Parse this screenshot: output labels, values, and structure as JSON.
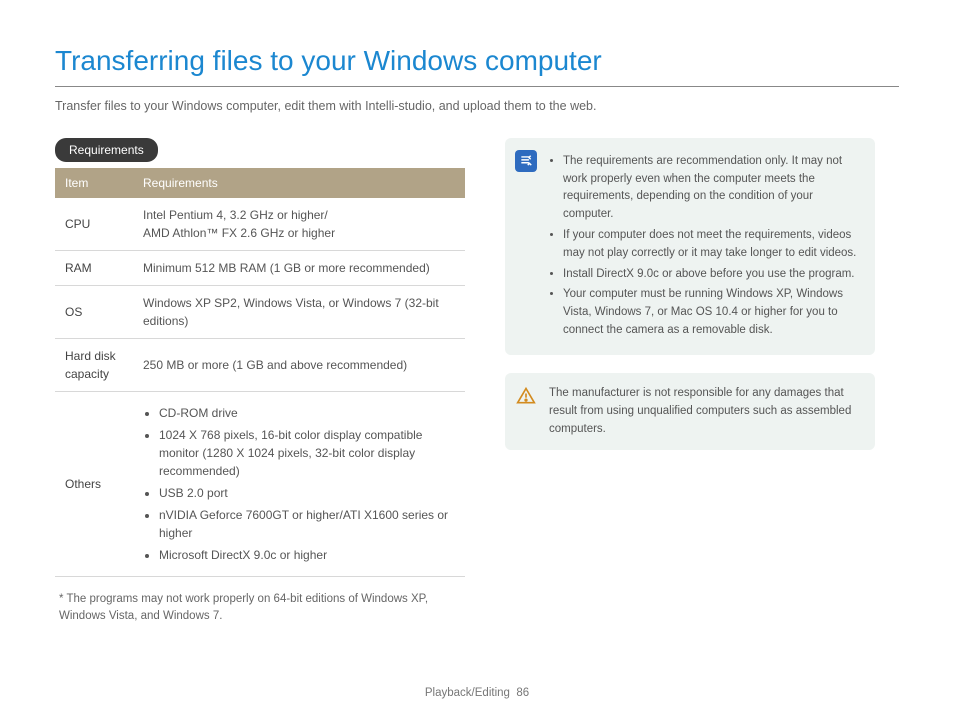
{
  "title": "Transferring files to your Windows computer",
  "intro": "Transfer files to your Windows computer, edit them with Intelli-studio, and upload them to the web.",
  "section_label": "Requirements",
  "table": {
    "head_item": "Item",
    "head_req": "Requirements",
    "rows": {
      "cpu_item": "CPU",
      "cpu_req": "Intel Pentium 4, 3.2 GHz or higher/\nAMD Athlon™ FX 2.6 GHz or higher",
      "ram_item": "RAM",
      "ram_req": "Minimum 512 MB RAM (1 GB or more recommended)",
      "os_item": "OS",
      "os_req": "Windows XP SP2, Windows Vista, or Windows 7 (32-bit editions)",
      "hdd_item": "Hard disk capacity",
      "hdd_req": "250 MB or more (1 GB and above recommended)",
      "others_item": "Others",
      "others_list": {
        "0": "CD-ROM drive",
        "1": "1024 X 768 pixels, 16-bit color display compatible monitor (1280 X 1024 pixels, 32-bit color display recommended)",
        "2": "USB 2.0 port",
        "3": "nVIDIA Geforce 7600GT or higher/ATI X1600 series or higher",
        "4": "Microsoft DirectX 9.0c or higher"
      }
    }
  },
  "footnote": "* The programs may not work properly on 64-bit editions of Windows XP, Windows Vista, and Windows 7.",
  "note_list": {
    "0": "The requirements are recommendation only. It may not work properly even when the computer meets the requirements, depending on the condition of your computer.",
    "1": "If your computer does not meet the requirements, videos may not play correctly or it may take longer to edit videos.",
    "2": "Install DirectX 9.0c or above before you use the program.",
    "3": "Your computer must be running Windows XP, Windows Vista, Windows 7, or Mac OS 10.4 or higher for you to connect the camera as a removable disk."
  },
  "warn_text": "The manufacturer is not responsible for any damages that result from using unqualified computers such as assembled computers.",
  "footer_section": "Playback/Editing",
  "footer_page": "86"
}
